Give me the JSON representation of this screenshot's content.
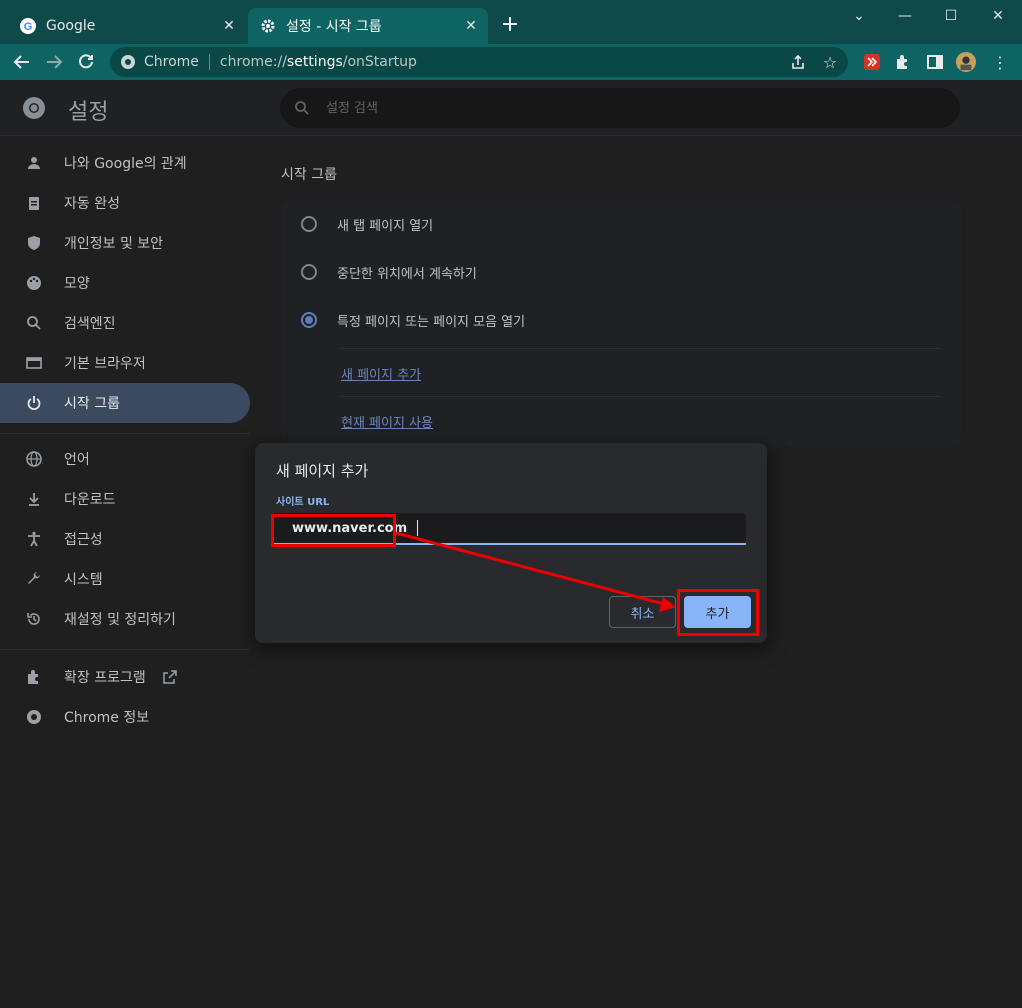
{
  "colors": {
    "tab_bar": "#0f4a4a",
    "toolbar": "#0e6363",
    "page_bg": "#1f1f1f",
    "accent": "#8ab4f8",
    "annotation": "#e00000"
  },
  "tabs": [
    {
      "title": "Google",
      "icon": "google-icon"
    },
    {
      "title": "설정 - 시작 그룹",
      "icon": "gear-icon",
      "active": true
    }
  ],
  "toolbar": {
    "chip": "Chrome",
    "url_prefix": "chrome://",
    "url_host": "settings",
    "url_path": "/onStartup"
  },
  "header": {
    "title": "설정",
    "search_placeholder": "설정 검색"
  },
  "sidebar": {
    "items": [
      {
        "label": "나와 Google의 관계",
        "icon": "person-icon"
      },
      {
        "label": "자동 완성",
        "icon": "clipboard-icon"
      },
      {
        "label": "개인정보 및 보안",
        "icon": "shield-icon"
      },
      {
        "label": "모양",
        "icon": "palette-icon"
      },
      {
        "label": "검색엔진",
        "icon": "search-icon"
      },
      {
        "label": "기본 브라우저",
        "icon": "browser-icon"
      },
      {
        "label": "시작 그룹",
        "icon": "power-icon",
        "active": true
      },
      {
        "label": "언어",
        "icon": "globe-icon"
      },
      {
        "label": "다운로드",
        "icon": "download-icon"
      },
      {
        "label": "접근성",
        "icon": "accessibility-icon"
      },
      {
        "label": "시스템",
        "icon": "wrench-icon"
      },
      {
        "label": "재설정 및 정리하기",
        "icon": "history-icon"
      },
      {
        "label": "확장 프로그램",
        "icon": "puzzle-icon"
      },
      {
        "label": "Chrome 정보",
        "icon": "chrome-icon"
      }
    ]
  },
  "main": {
    "section_title": "시작 그룹",
    "options": [
      {
        "label": "새 탭 페이지 열기",
        "checked": false
      },
      {
        "label": "중단한 위치에서 계속하기",
        "checked": false
      },
      {
        "label": "특정 페이지 또는 페이지 모음 열기",
        "checked": true
      }
    ],
    "links": {
      "add_page": "새 페이지 추가",
      "use_current": "현재 페이지 사용"
    }
  },
  "dialog": {
    "title": "새 페이지 추가",
    "field_label": "사이트 URL",
    "field_value": "www.naver.com",
    "cancel_label": "취소",
    "add_label": "추가"
  }
}
